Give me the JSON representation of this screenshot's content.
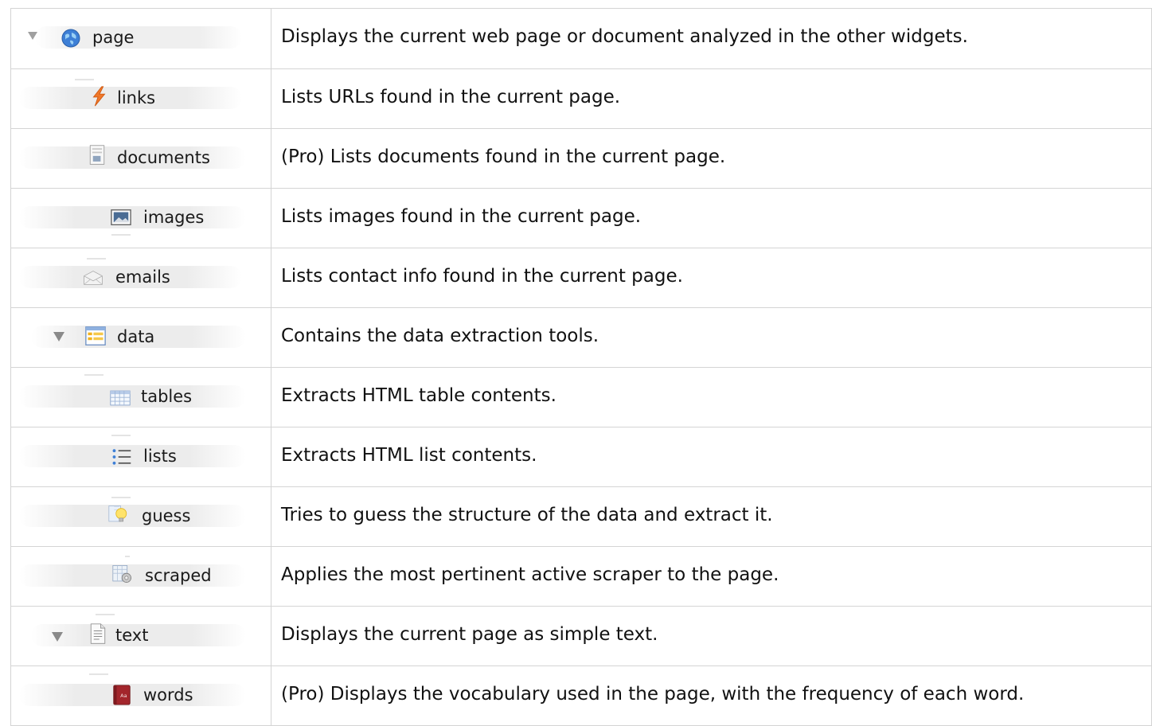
{
  "rows": [
    {
      "name": "page",
      "icon": "globe-icon",
      "description": "Displays the current web page or document analyzed in the other widgets."
    },
    {
      "name": "links",
      "icon": "lightning-icon",
      "description": "Lists URLs found in the current page."
    },
    {
      "name": "documents",
      "icon": "document-icon",
      "description": "(Pro) Lists documents found in the current page."
    },
    {
      "name": "images",
      "icon": "image-icon",
      "description": "Lists images found in the current page."
    },
    {
      "name": "emails",
      "icon": "envelope-icon",
      "description": "Lists contact info found in the current page."
    },
    {
      "name": "data",
      "icon": "data-grid-icon",
      "description": "Contains the data extraction tools."
    },
    {
      "name": "tables",
      "icon": "table-icon",
      "description": "Extracts HTML table contents."
    },
    {
      "name": "lists",
      "icon": "list-icon",
      "description": "Extracts HTML list contents."
    },
    {
      "name": "guess",
      "icon": "lightbulb-icon",
      "description": "Tries to guess the structure of the data and extract it."
    },
    {
      "name": "scraped",
      "icon": "scraper-gear-icon",
      "description": "Applies the most pertinent active scraper to the page."
    },
    {
      "name": "text",
      "icon": "text-file-icon",
      "description": "Displays the current page as simple text."
    },
    {
      "name": "words",
      "icon": "book-icon",
      "description": "(Pro) Displays the vocabulary used in the page, with the frequency of each word."
    }
  ]
}
